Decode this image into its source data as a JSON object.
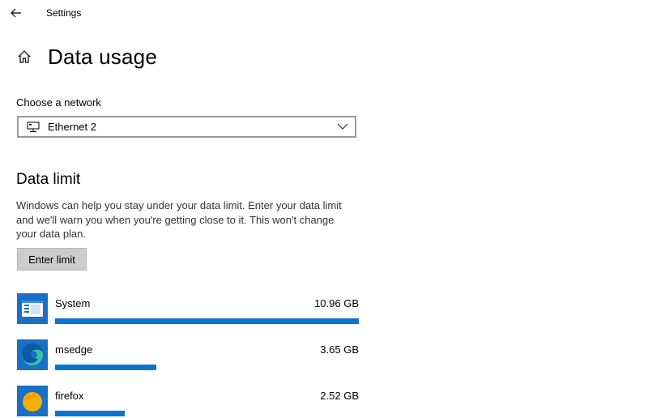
{
  "window": {
    "title": "Settings"
  },
  "header": {
    "title": "Data usage"
  },
  "network": {
    "label": "Choose a network",
    "selected": "Ethernet 2"
  },
  "data_limit": {
    "title": "Data limit",
    "description": "Windows can help you stay under your data limit. Enter your data limit and we'll warn you when you're getting close to it. This won't change your data plan.",
    "button_label": "Enter limit"
  },
  "apps": [
    {
      "name": "System",
      "usage": "10.96 GB",
      "usage_fraction": 1.0
    },
    {
      "name": "msedge",
      "usage": "3.65 GB",
      "usage_fraction": 0.333
    },
    {
      "name": "firefox",
      "usage": "2.52 GB",
      "usage_fraction": 0.23
    }
  ],
  "colors": {
    "accent": "#0a74d4",
    "button_bg": "#cccccc",
    "select_border": "#999999"
  }
}
